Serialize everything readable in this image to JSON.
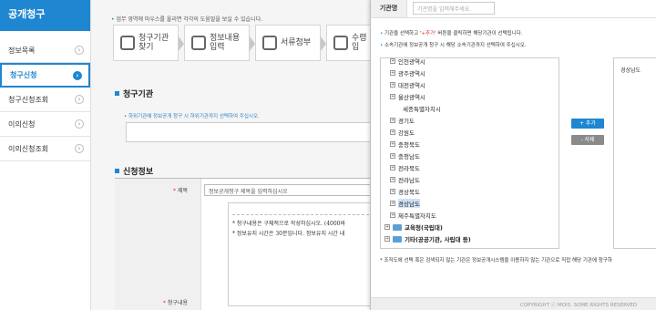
{
  "sidebar": {
    "title": "공개청구",
    "items": [
      {
        "label": "정보목록"
      },
      {
        "label": "청구신청"
      },
      {
        "label": "청구신청조회"
      },
      {
        "label": "이의신청"
      },
      {
        "label": "이의신청조회"
      }
    ],
    "arrow": "›"
  },
  "main": {
    "notice": "업무 영역에 마우스를 올리면 각각의 도움말을 보실 수 있습니다.",
    "steps": [
      {
        "label": "청구기관 찾기"
      },
      {
        "label": "정보내용 입력"
      },
      {
        "label": "서류첨부"
      },
      {
        "label": "수령 정보입"
      }
    ],
    "org_section_title": "청구기관",
    "org_hint": "하위기관에 정보공개 청구 시 하위기관까지 선택하여 주십시오.",
    "info_section_title": "신청정보",
    "subject_label": "제목",
    "subject_value": "정보공개청구 제목을 입력하십시오",
    "content_label": "청구내용",
    "content_lines": [
      "* 청구내용은 구체적으로 작성하십시오. (4000바",
      "* 정보유지 시간은 30분입니다. 정보유지 시간 내"
    ],
    "required_mark": "*"
  },
  "popup": {
    "org_name_label": "기관명",
    "org_name_placeholder": "기관명을 입력해주세요.",
    "note1_pre": "기관을 선택하고 '",
    "note1_hl": "+추가",
    "note1_post": "' 버튼을 클릭하면 해당기관이 선택됩니다.",
    "note2": "소속기관에 정보공개 청구 시 해당 소속기관까지 선택하여 주십시오.",
    "tree_items": [
      {
        "label": "인천광역시"
      },
      {
        "label": "광주광역시"
      },
      {
        "label": "대전광역시"
      },
      {
        "label": "울산광역시"
      },
      {
        "label": "세종특별자치시"
      },
      {
        "label": "경기도"
      },
      {
        "label": "강원도"
      },
      {
        "label": "충청북도"
      },
      {
        "label": "충청남도"
      },
      {
        "label": "전라북도"
      },
      {
        "label": "전라남도"
      },
      {
        "label": "경상북도"
      },
      {
        "label": "경상남도"
      },
      {
        "label": "제주특별자치도"
      },
      {
        "label": "교육청(국립대)"
      },
      {
        "label": "기타(공공기관, 사립대 등)"
      }
    ],
    "add_button": "+ 추가",
    "delete_button": "- 삭제",
    "selected_items": [
      "경상남도"
    ],
    "footer_note": "* 조직도에 선택 혹은 검색되지 않는 기관은 정보공개시스템을 이용하지 않는 기관으로 직접 해당 기관에 청구하",
    "copyright": "COPYRIGHT ⓒ MOIS. SOME RIGHTS RESERVED"
  },
  "colors": {
    "accent": "#1f86d1",
    "delete_button": "#8a8a8a",
    "highlight_red": "#d33333"
  }
}
